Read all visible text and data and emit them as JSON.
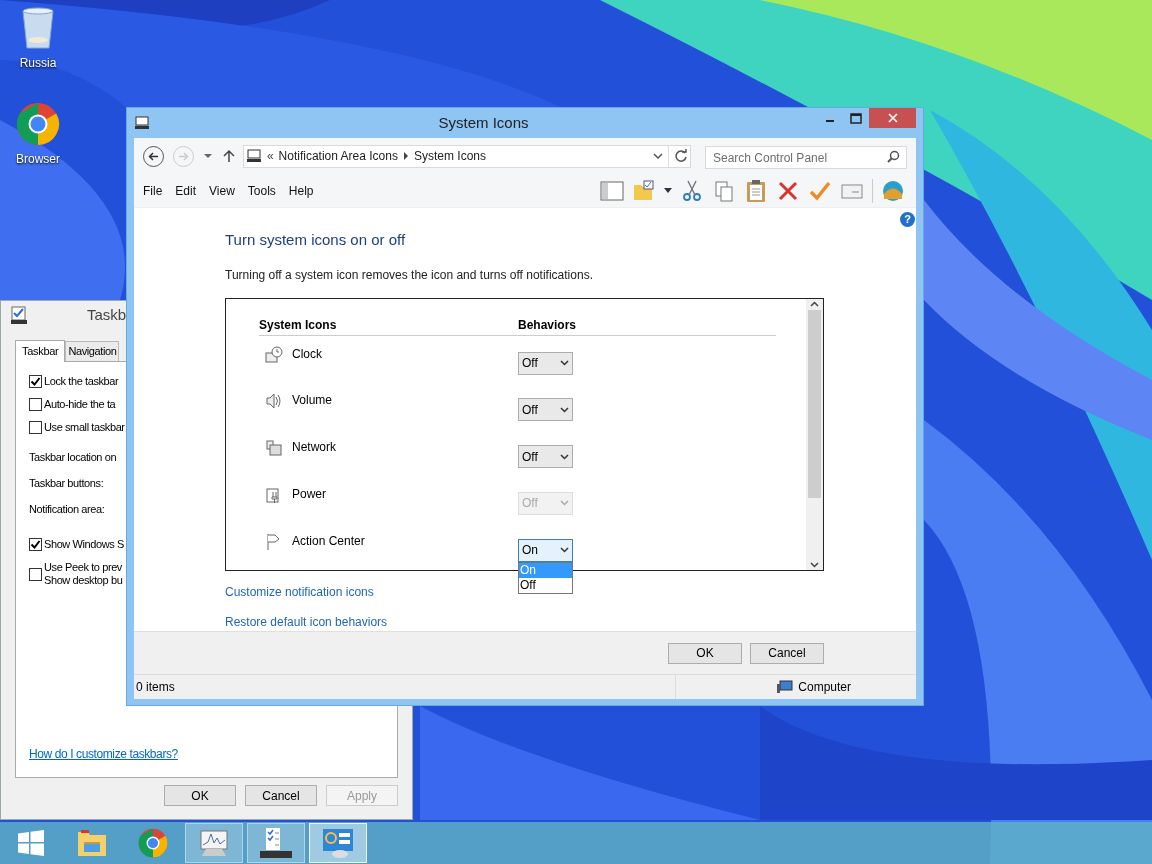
{
  "desktop_icons": [
    {
      "label": "Russia",
      "kind": "bin"
    },
    {
      "label": "Browser",
      "kind": "browser"
    }
  ],
  "taskbar_properties": {
    "title": "Taskb",
    "tabs": [
      {
        "label": "Taskbar",
        "selected": true
      },
      {
        "label": "Navigation",
        "selected": false
      }
    ],
    "options": [
      {
        "kind": "checkbox",
        "label": "Lock the taskbar",
        "checked": true
      },
      {
        "kind": "checkbox",
        "label": "Auto-hide the ta",
        "checked": false
      },
      {
        "kind": "checkbox",
        "label": "Use small taskbar",
        "checked": false
      },
      {
        "kind": "label",
        "label": "Taskbar location on"
      },
      {
        "kind": "label",
        "label": "Taskbar buttons:"
      },
      {
        "kind": "label",
        "label": "Notification area:"
      },
      {
        "kind": "checkbox",
        "label": "Show Windows S",
        "checked": true
      },
      {
        "kind": "checkbox",
        "label": "Use Peek to prev",
        "label2": "Show desktop bu",
        "checked": false
      }
    ],
    "help_link": "How do I customize taskbars?",
    "buttons": [
      {
        "label": "OK",
        "disabled": false
      },
      {
        "label": "Cancel",
        "disabled": false
      },
      {
        "label": "Apply",
        "disabled": true
      }
    ]
  },
  "window": {
    "title": "System Icons",
    "nav": [
      {
        "kind": "back",
        "disabled": false
      },
      {
        "kind": "forward",
        "disabled": true
      }
    ],
    "breadcrumb_overflow": "«",
    "breadcrumb": [
      "Notification Area Icons",
      "System Icons"
    ],
    "search": {
      "placeholder": "Search Control Panel"
    },
    "menu": [
      "File",
      "Edit",
      "View",
      "Tools",
      "Help"
    ],
    "help_glyph": "?",
    "heading": "Turn system icons on or off",
    "description": "Turning off a system icon removes the icon and turns off notifications.",
    "columns": [
      "System Icons",
      "Behaviors"
    ],
    "rows": [
      {
        "name": "Clock",
        "kind": "clock",
        "value": "Off",
        "disabled": false,
        "expanded": false
      },
      {
        "name": "Volume",
        "kind": "volume",
        "value": "Off",
        "disabled": false,
        "expanded": false
      },
      {
        "name": "Network",
        "kind": "network",
        "value": "Off",
        "disabled": false,
        "expanded": false
      },
      {
        "name": "Power",
        "kind": "power",
        "value": "Off",
        "disabled": true,
        "expanded": false
      },
      {
        "name": "Action Center",
        "kind": "flag",
        "value": "On",
        "disabled": false,
        "expanded": true
      }
    ],
    "dropdown_options": [
      {
        "label": "On",
        "selected": true
      },
      {
        "label": "Off",
        "selected": false
      }
    ],
    "links": [
      "Customize notification icons",
      "Restore default icon behaviors"
    ],
    "buttons": [
      "OK",
      "Cancel"
    ],
    "status_bar": {
      "items": "0 items",
      "location": "Computer"
    }
  },
  "taskbar": [
    {
      "kind": "start",
      "open": false,
      "selected": false
    },
    {
      "kind": "folder",
      "open": false,
      "selected": false
    },
    {
      "kind": "browser",
      "open": false,
      "selected": false
    },
    {
      "kind": "monitor",
      "open": true,
      "selected": false
    },
    {
      "kind": "checklist",
      "open": true,
      "selected": false
    },
    {
      "kind": "panel",
      "open": true,
      "selected": true
    }
  ]
}
